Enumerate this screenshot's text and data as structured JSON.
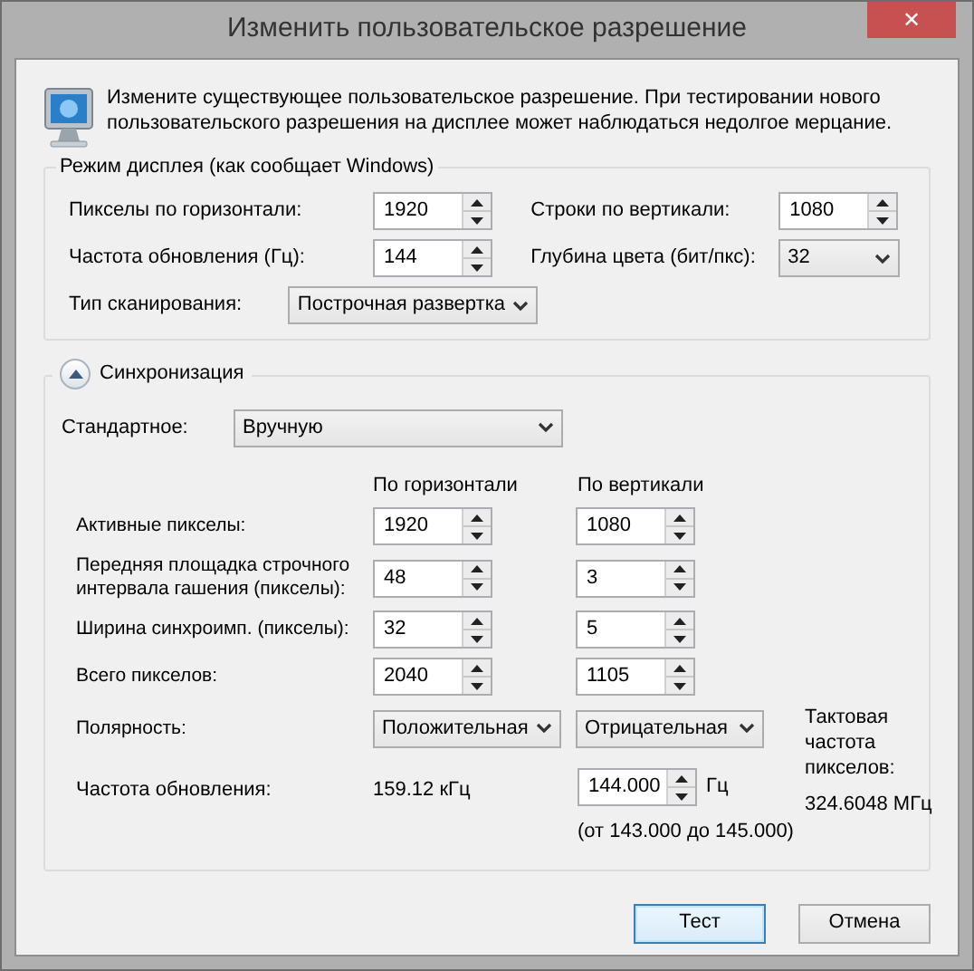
{
  "window": {
    "title": "Изменить пользовательское разрешение",
    "close": "✕"
  },
  "description": "Измените существующее пользовательское разрешение. При тестировании нового пользовательского разрешения на дисплее может наблюдаться недолгое мерцание.",
  "display_mode": {
    "title": "Режим дисплея (как сообщает Windows)",
    "rows": [
      [
        {
          "label": "Пикселы по горизонтали:",
          "kind": "spinner",
          "value": "1920"
        },
        {
          "label": "Строки по вертикали:",
          "kind": "spinner",
          "value": "1080"
        }
      ],
      [
        {
          "label": "Частота обновления (Гц):",
          "kind": "spinner",
          "value": "144"
        },
        {
          "label": "Глубина цвета (бит/пкс):",
          "kind": "select",
          "value": "32"
        }
      ],
      [
        {
          "label": "Тип сканирования:",
          "kind": "select",
          "value": "Построчная развертка"
        }
      ]
    ]
  },
  "timing": {
    "title": "Синхронизация",
    "expanded": true,
    "standard": {
      "label": "Стандартное:",
      "value": "Вручную"
    },
    "column_headers": [
      "По горизонтали",
      "По вертикали"
    ],
    "rows": [
      {
        "label": "Активные пикселы:",
        "kind": "spinner",
        "horizontal": "1920",
        "vertical": "1080"
      },
      {
        "label": "Передняя площадка строчного интервала гашения (пикселы):",
        "kind": "spinner",
        "horizontal": "48",
        "vertical": "3"
      },
      {
        "label": "Ширина синхроимп. (пикселы):",
        "kind": "spinner",
        "horizontal": "32",
        "vertical": "5"
      },
      {
        "label": "Всего пикселов:",
        "kind": "spinner",
        "horizontal": "2040",
        "vertical": "1105"
      },
      {
        "label": "Полярность:",
        "kind": "select",
        "horizontal": "Положительная",
        "vertical": "Отрицательная"
      }
    ],
    "refresh": {
      "label": "Частота обновления:",
      "horizontal": "159.12 кГц",
      "vertical": "144.000",
      "unit": "Гц",
      "range": "(от 143.000 до 145.000)"
    },
    "pixel_clock": {
      "label": "Тактовая частота пикселов:",
      "value": "324.6048 МГц"
    }
  },
  "buttons": [
    {
      "label": "Тест",
      "default": true
    },
    {
      "label": "Отмена",
      "default": false
    }
  ]
}
